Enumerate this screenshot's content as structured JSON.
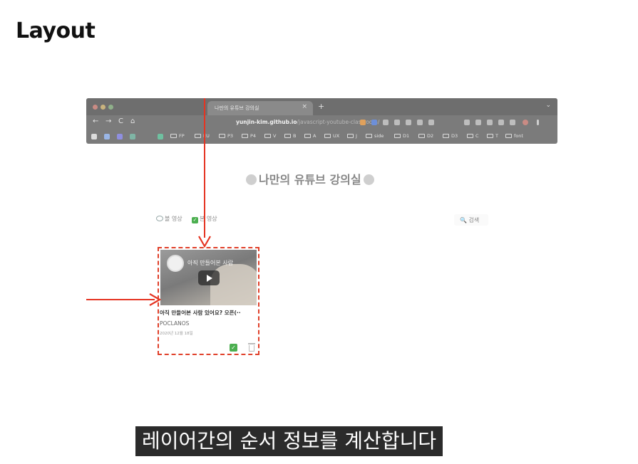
{
  "slide": {
    "title": "Layout"
  },
  "browser": {
    "tab_title": "나만의 유튜브 강의실",
    "tab_close": "×",
    "new_tab": "+",
    "tab_menu": "⌄",
    "nav": {
      "back": "←",
      "forward": "→",
      "reload": "C",
      "home": "⌂"
    },
    "url": {
      "host": "yunjin-kim.github.io",
      "path": "/javascript-youtube-classroom/"
    },
    "bookmarks": [
      "FP",
      "EU",
      "P3",
      "P4",
      "V",
      "B",
      "A",
      "UX",
      "J",
      "side",
      "D1",
      "D2",
      "D3",
      "C",
      "T",
      "font"
    ]
  },
  "app": {
    "heading": "나만의 유튜브 강의실",
    "filters": {
      "to_watch": "볼 영상",
      "watched": "본 영상"
    },
    "search_label": "🔍 검색",
    "video": {
      "thumb_title": "아직 만들어본 사람",
      "title": "아직 만들어본 사람 있어요? 오픈(··",
      "channel": "POCLANOS",
      "date": "2020년 12월 18일"
    },
    "check_symbol": "✓"
  },
  "subtitle": "레이어간의 순서 정보를 계산합니다",
  "colors": {
    "arrow": "#e53422",
    "card_border": "#e0402a",
    "check": "#4caf50"
  }
}
